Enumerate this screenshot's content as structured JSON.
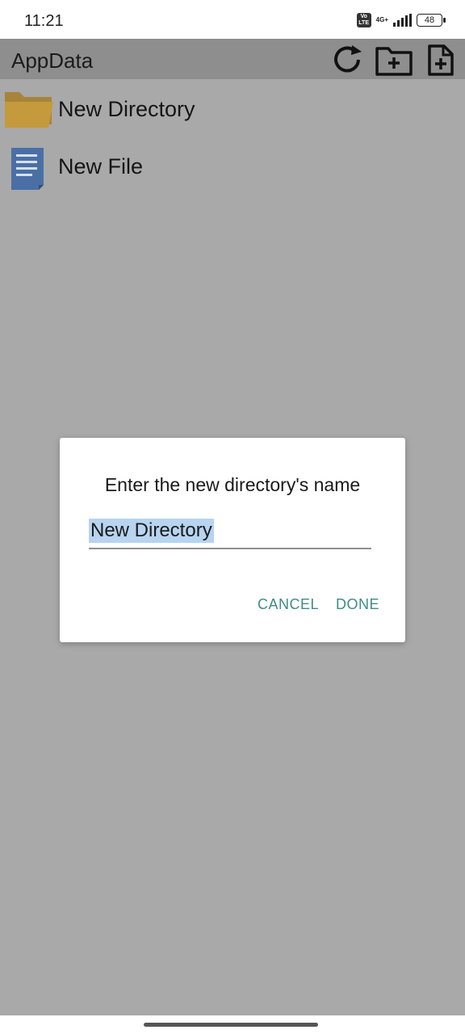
{
  "status": {
    "time": "11:21",
    "volte": "Vo LTE",
    "network": "4G+",
    "battery": "48"
  },
  "appbar": {
    "title": "AppData",
    "icons": [
      "refresh-icon",
      "new-folder-icon",
      "new-file-icon"
    ]
  },
  "list": {
    "items": [
      {
        "label": "New Directory",
        "icon": "folder-icon"
      },
      {
        "label": "New File",
        "icon": "file-icon"
      }
    ]
  },
  "dialog": {
    "title": "Enter the new directory's name",
    "input_value": "New Directory",
    "cancel_label": "CANCEL",
    "done_label": "DONE"
  },
  "colors": {
    "scrim": "#a9a9a9",
    "accent": "#3f8d84",
    "selection": "#b7d4f0",
    "folder": "#c49a3c",
    "file": "#4a6fa5"
  }
}
